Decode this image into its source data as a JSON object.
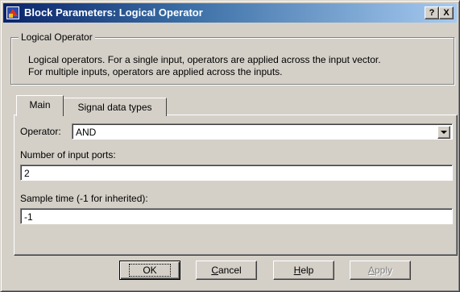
{
  "window": {
    "title": "Block Parameters: Logical Operator",
    "icon": "simulink-block-icon",
    "help_button": "?",
    "close_button": "X"
  },
  "group": {
    "label": "Logical Operator",
    "description_line1": "Logical operators.  For a single input, operators are applied across the input vector.",
    "description_line2": "For multiple inputs, operators are applied across the inputs."
  },
  "tabs": [
    {
      "label": "Main",
      "selected": true
    },
    {
      "label": "Signal data types",
      "selected": false
    }
  ],
  "main": {
    "operator_label": "Operator:",
    "operator_value": "AND",
    "num_inputs_label": "Number of input ports:",
    "num_inputs_value": "2",
    "sample_time_label": "Sample time (-1 for inherited):",
    "sample_time_value": "-1"
  },
  "buttons": {
    "ok": "OK",
    "cancel_rest": "ancel",
    "cancel_mnemonic": "C",
    "help_rest": "elp",
    "help_mnemonic": "H",
    "apply_rest": "pply",
    "apply_mnemonic": "A"
  },
  "colors": {
    "titlebar_start": "#0a246a",
    "titlebar_end": "#a6caf0",
    "face": "#d4d0c8"
  }
}
